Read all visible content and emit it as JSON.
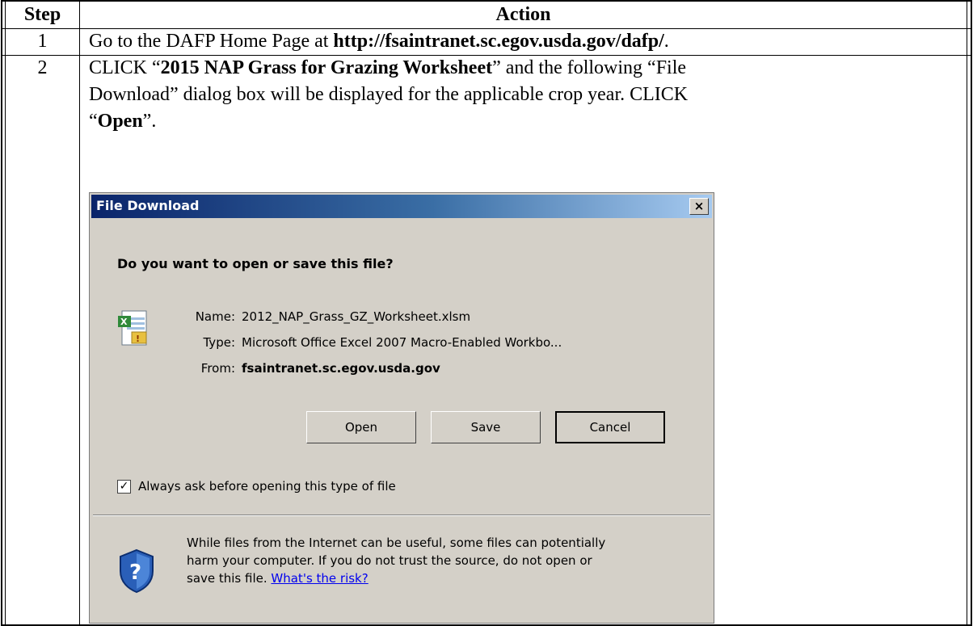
{
  "table": {
    "header_step": "Step",
    "header_action": "Action",
    "rows": [
      {
        "step": "1",
        "action_prefix": "Go to the DAFP Home Page at ",
        "action_bold": "http://fsaintranet.sc.egov.usda.gov/dafp/",
        "action_suffix": "."
      },
      {
        "step": "2",
        "line1_prefix": "CLICK “",
        "line1_bold": "2015 NAP Grass for Grazing Worksheet",
        "line1_suffix": "” and the following “File",
        "line2": "Download” dialog box will be displayed for the applicable crop year.  CLICK",
        "line3_prefix": "“",
        "line3_bold": "Open",
        "line3_suffix": "”."
      }
    ]
  },
  "dialog": {
    "title": "File Download",
    "close_glyph": "×",
    "question": "Do you want to open or save this file?",
    "name_label": "Name:",
    "name_value": "2012_NAP_Grass_GZ_Worksheet.xlsm",
    "type_label": "Type:",
    "type_value": "Microsoft Office Excel 2007 Macro-Enabled Workbo...",
    "from_label": "From:",
    "from_value": "fsaintranet.sc.egov.usda.gov",
    "open_label": "Open",
    "save_label": "Save",
    "cancel_label": "Cancel",
    "checkbox_checked": true,
    "checkbox_glyph": "✓",
    "checkbox_label": "Always ask before opening this type of file",
    "warning_line1": "While files from the Internet can be useful, some files can potentially",
    "warning_line2": "harm your computer. If you do not trust the source, do not open or",
    "warning_line3_prefix": "save this file. ",
    "risk_link": "What's the risk?"
  }
}
